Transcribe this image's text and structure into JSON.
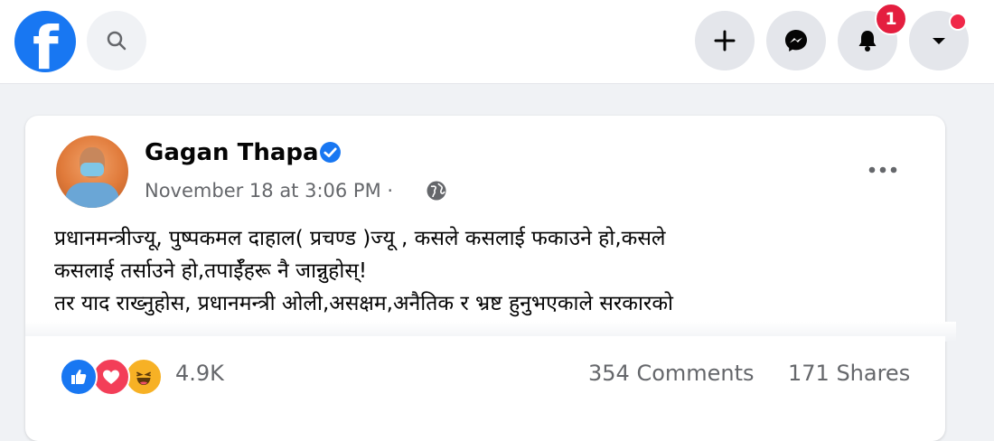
{
  "topbar": {
    "logo_letter": "f",
    "notification_count": "1"
  },
  "post": {
    "author": "Gagan Thapa",
    "timestamp": "November 18 at 3:06 PM",
    "separator": "·",
    "text_lines": [
      "प्रधानमन्त्रीज्यू, पुष्पकमल दाहाल( प्रचण्ड )ज्यू , कसले कसलाई फकाउने हो,कसले",
      "कसलाई तर्साउने हो,तपाईँहरू नै जान्नुहोस्!",
      "तर याद राख्नुहोस, प्रधानमन्त्री ओली,असक्षम,अनैतिक र भ्रष्ट हुनुभएकाले सरकारको"
    ],
    "reactions_count": "4.9K",
    "comments": "354 Comments",
    "shares": "171 Shares"
  },
  "colors": {
    "brand": "#1877f2",
    "badge": "#e41e3f",
    "secondary_text": "#65676b"
  },
  "icons": [
    "facebook-logo",
    "search-icon",
    "plus-icon",
    "messenger-icon",
    "bell-icon",
    "caret-down-icon",
    "verified-icon",
    "globe-icon",
    "more-icon",
    "like-reaction-icon",
    "love-reaction-icon",
    "haha-reaction-icon"
  ]
}
